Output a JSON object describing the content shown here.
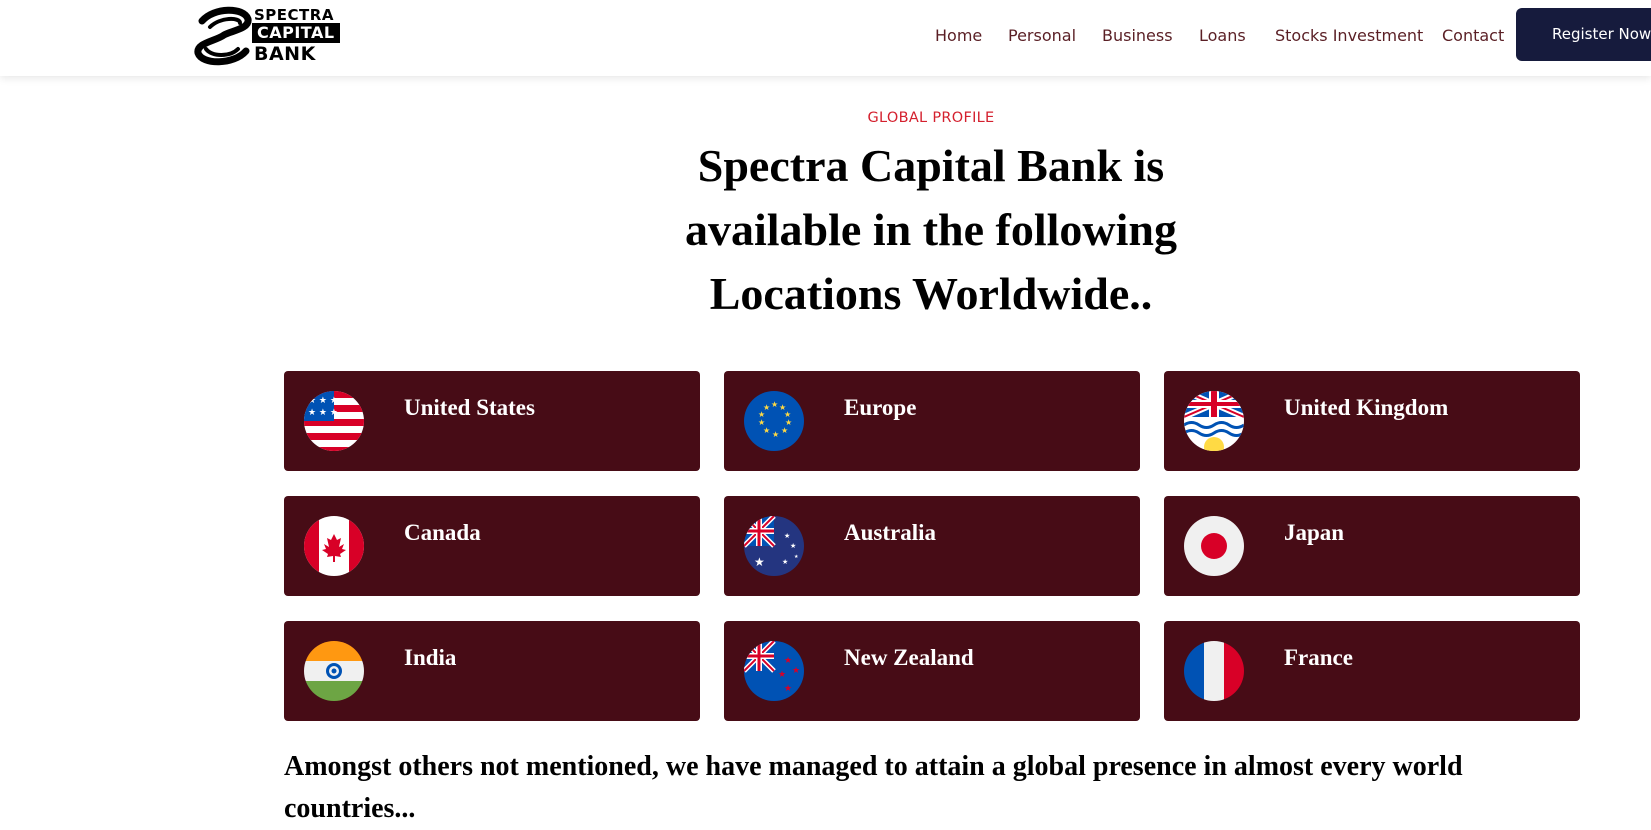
{
  "header": {
    "logo": {
      "line1": "SPECTRA",
      "line2": "CAPITAL",
      "line3": "BANK"
    },
    "nav": [
      "Home",
      "Personal",
      "Business",
      "Loans",
      "Stocks Investment",
      "Contact"
    ],
    "register_label": "Register Now"
  },
  "hero": {
    "eyebrow": "GLOBAL PROFILE",
    "headline": "Spectra Capital Bank is available in the following Locations Worldwide.."
  },
  "locations": [
    {
      "label": "United States",
      "flag_icon": "us-flag-icon"
    },
    {
      "label": "Europe",
      "flag_icon": "eu-flag-icon"
    },
    {
      "label": "United Kingdom",
      "flag_icon": "british-columbia-flag-icon"
    },
    {
      "label": "Canada",
      "flag_icon": "canada-flag-icon"
    },
    {
      "label": "Australia",
      "flag_icon": "australia-flag-icon"
    },
    {
      "label": "Japan",
      "flag_icon": "japan-flag-icon"
    },
    {
      "label": "India",
      "flag_icon": "india-flag-icon"
    },
    {
      "label": "New Zealand",
      "flag_icon": "new-zealand-flag-icon"
    },
    {
      "label": "France",
      "flag_icon": "france-flag-icon"
    }
  ],
  "footer_text": "Amongst others not mentioned, we have managed to attain a global presence in almost every world countries...",
  "colors": {
    "card_bg": "#470c16",
    "eyebrow": "#d4202e",
    "nav_text": "#5a1f25",
    "button_bg": "#161b3d"
  }
}
